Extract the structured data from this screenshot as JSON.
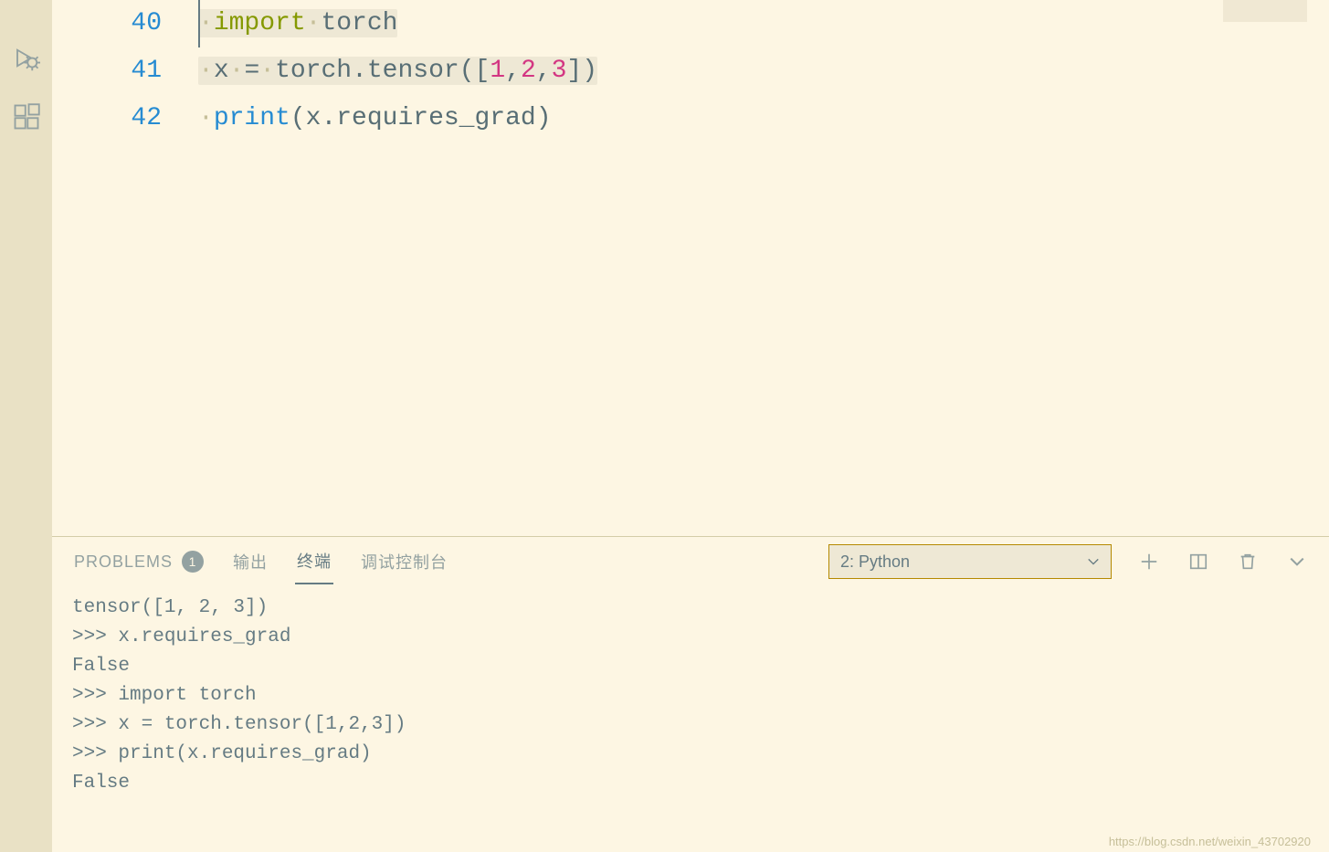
{
  "editor": {
    "line_numbers": [
      "40",
      "41",
      "42"
    ],
    "lines": {
      "l0": {
        "dot": "·",
        "import": "import",
        "dot2": "·",
        "torch": "torch"
      },
      "l1": {
        "dot": "·",
        "x": "x",
        "dot2": "·",
        "eq": "=",
        "dot3": "·",
        "torch": "torch",
        "tensor": ".tensor",
        "lp": "(",
        "lb": "[",
        "n1": "1",
        "c1": ",",
        "n2": "2",
        "c2": ",",
        "n3": "3",
        "rb": "]",
        ")": ")"
      },
      "l2": {
        "dot": "·",
        "print": "print",
        "lp": "(",
        "x": "x",
        "req": ".requires_grad",
        "rp": ")"
      }
    }
  },
  "panel": {
    "tabs": {
      "problems": "PROBLEMS",
      "problems_badge": "1",
      "output": "输出",
      "terminal": "终端",
      "debug_console": "调试控制台"
    },
    "terminal_select": "2: Python",
    "terminal_output": "tensor([1, 2, 3])\n>>> x.requires_grad\nFalse\n>>> import torch\n>>> x = torch.tensor([1,2,3])\n>>> print(x.requires_grad)\nFalse"
  },
  "watermark": "https://blog.csdn.net/weixin_43702920"
}
